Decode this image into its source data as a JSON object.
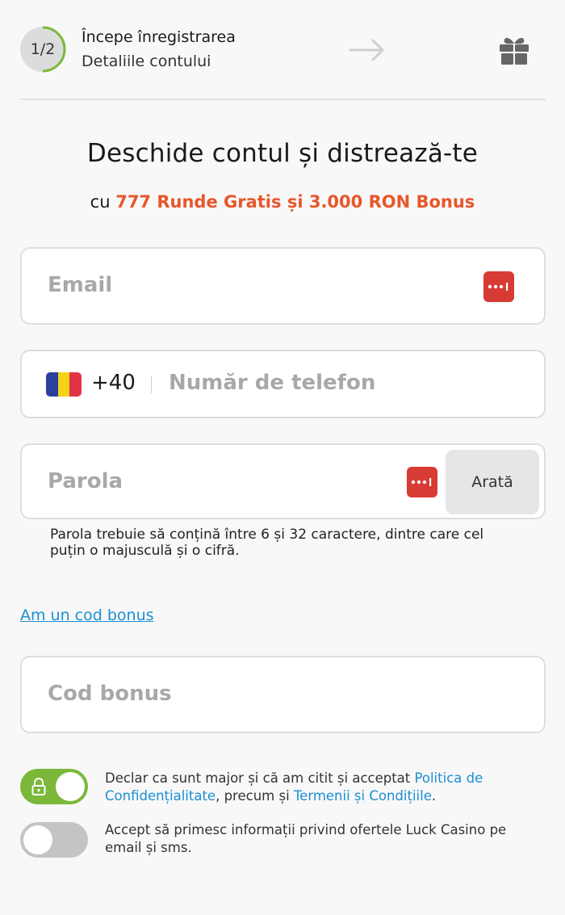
{
  "header": {
    "step": "1/2",
    "step_progress": 0.5,
    "title": "Începe înregistrarea",
    "subtitle": "Detaliile contului",
    "arrow_icon": "arrow-right-icon",
    "gift_icon": "gift-icon"
  },
  "title": "Deschide contul și distrează-te",
  "subtitle": {
    "prefix": "cu ",
    "highlight": "777 Runde Gratis și 3.000 RON Bonus"
  },
  "email": {
    "placeholder": "Email"
  },
  "phone": {
    "prefix": "+40",
    "placeholder": "Număr de telefon",
    "flag": "romania-flag"
  },
  "password": {
    "placeholder": "Parola",
    "show_label": "Arată"
  },
  "password_hint": "Parola trebuie să conțină între 6 și 32 caractere, dintre care cel puțin o majusculă și o cifră.",
  "bonus_link": "Am un cod bonus",
  "bonus_code": {
    "placeholder": "Cod bonus"
  },
  "consent": {
    "terms_text_1": "Declar ca sunt major și că am citit și acceptat ",
    "privacy_link": "Politica de Confidențialitate",
    "terms_text_2": ", precum și ",
    "terms_link": "Termenii și Condițiile",
    "terms_text_3": ".",
    "terms_checked": true,
    "marketing_text": "Accept să primesc informații privind ofertele Luck Casino pe email și sms.",
    "marketing_checked": false
  },
  "colors": {
    "accent": "#e8562a",
    "link": "#1a8fd3",
    "toggle_on": "#7bb83a",
    "toggle_off": "#c4c4c4",
    "password_manager": "#d83a34"
  }
}
